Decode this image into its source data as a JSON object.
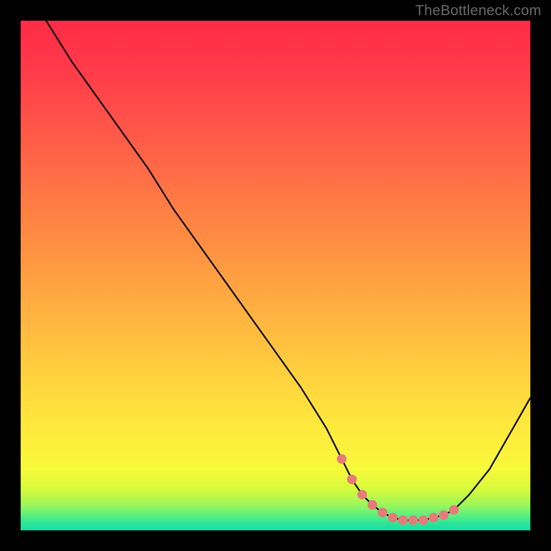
{
  "watermark": "TheBottleneck.com",
  "chart_data": {
    "type": "line",
    "title": "",
    "xlabel": "",
    "ylabel": "",
    "xlim": [
      0,
      100
    ],
    "ylim": [
      0,
      100
    ],
    "grid": false,
    "series": [
      {
        "name": "bottleneck-curve",
        "x": [
          5,
          10,
          15,
          20,
          25,
          30,
          35,
          40,
          45,
          50,
          55,
          60,
          63,
          65,
          67,
          69,
          71,
          73,
          75,
          77,
          79,
          81,
          83,
          85,
          88,
          92,
          96,
          100
        ],
        "values": [
          100,
          92,
          85,
          78,
          71,
          63,
          56,
          49,
          42,
          35,
          28,
          20,
          14,
          10,
          7,
          5,
          3.5,
          2.5,
          2,
          2,
          2,
          2.5,
          3,
          4,
          7,
          12,
          19,
          26
        ]
      },
      {
        "name": "optimal-zone-markers",
        "x": [
          63,
          65,
          67,
          69,
          71,
          73,
          75,
          77,
          79,
          81,
          83,
          85
        ],
        "values": [
          14,
          10,
          7,
          5,
          3.5,
          2.5,
          2,
          2,
          2,
          2.5,
          3,
          4
        ]
      }
    ],
    "marker_color": "#e77a7a",
    "curve_color": "#000000",
    "gradient_stops": [
      {
        "pos": 0.0,
        "color": "#ff2b47"
      },
      {
        "pos": 0.45,
        "color": "#ff9442"
      },
      {
        "pos": 0.8,
        "color": "#ffe93c"
      },
      {
        "pos": 0.95,
        "color": "#9cf75a"
      },
      {
        "pos": 1.0,
        "color": "#16dea6"
      }
    ]
  }
}
